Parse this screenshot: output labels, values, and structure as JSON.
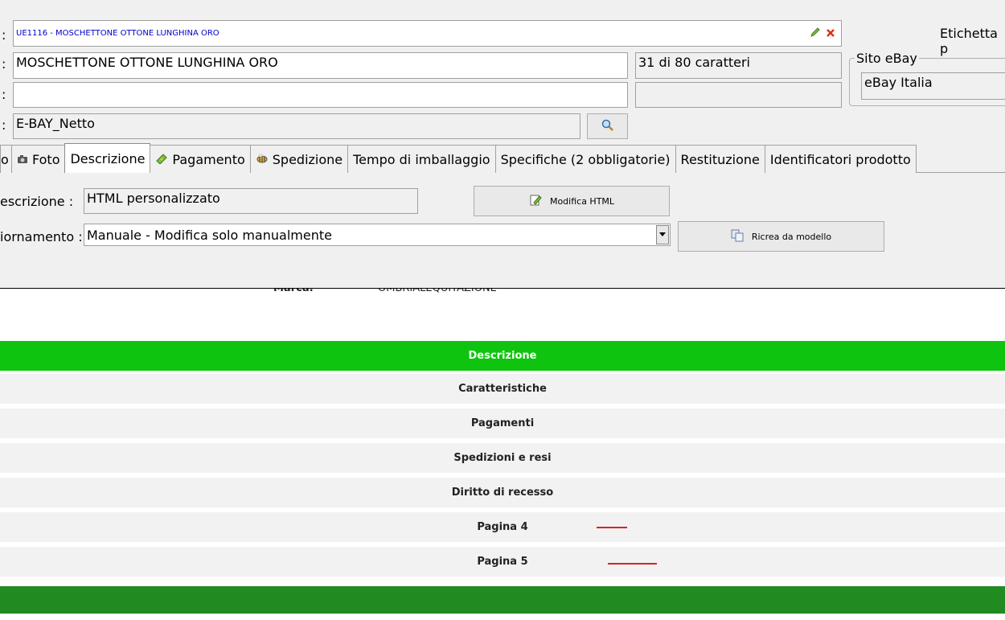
{
  "form": {
    "colon": ":",
    "title_bar_text": "UE1116 - MOSCHETTONE OTTONE LUNGHINA ORO",
    "title_value": "MOSCHETTONE OTTONE LUNGHINA ORO",
    "char_count": "31 di 80 caratteri",
    "subtitle_value": "",
    "category_value": "E-BAY_Netto",
    "etichetta_label": "Etichetta p",
    "sito_group_label": "Sito eBay",
    "sito_value": "eBay Italia"
  },
  "tabs": [
    {
      "label": "o",
      "icon": ""
    },
    {
      "label": "Foto",
      "icon": "camera-icon"
    },
    {
      "label": "Descrizione",
      "icon": ""
    },
    {
      "label": "Pagamento",
      "icon": "money-icon"
    },
    {
      "label": "Spedizione",
      "icon": "bee-icon"
    },
    {
      "label": "Tempo di imballaggio",
      "icon": ""
    },
    {
      "label": "Specifiche (2 obbligatorie)",
      "icon": ""
    },
    {
      "label": "Restituzione",
      "icon": ""
    },
    {
      "label": "Identificatori prodotto",
      "icon": ""
    }
  ],
  "description": {
    "label": "escrizione :",
    "value": "HTML personalizzato",
    "edit_button": "Modifica HTML",
    "update_label": "iornamento :",
    "update_value": "Manuale - Modifica solo manualmente",
    "recreate_button": "Ricrea da modello"
  },
  "preview": {
    "partial_text_left": "Marca:",
    "partial_text_right": "OMBRIALEQUITAZIONE",
    "header": "Descrizione",
    "rows": [
      "Caratteristiche",
      "Pagamenti",
      "Spedizioni e resi",
      "Diritto di recesso",
      "Pagina 4",
      "Pagina 5"
    ]
  },
  "colors": {
    "green_header": "#0ec40e",
    "footer_green": "#218a21",
    "link_blue": "#0000cc"
  }
}
